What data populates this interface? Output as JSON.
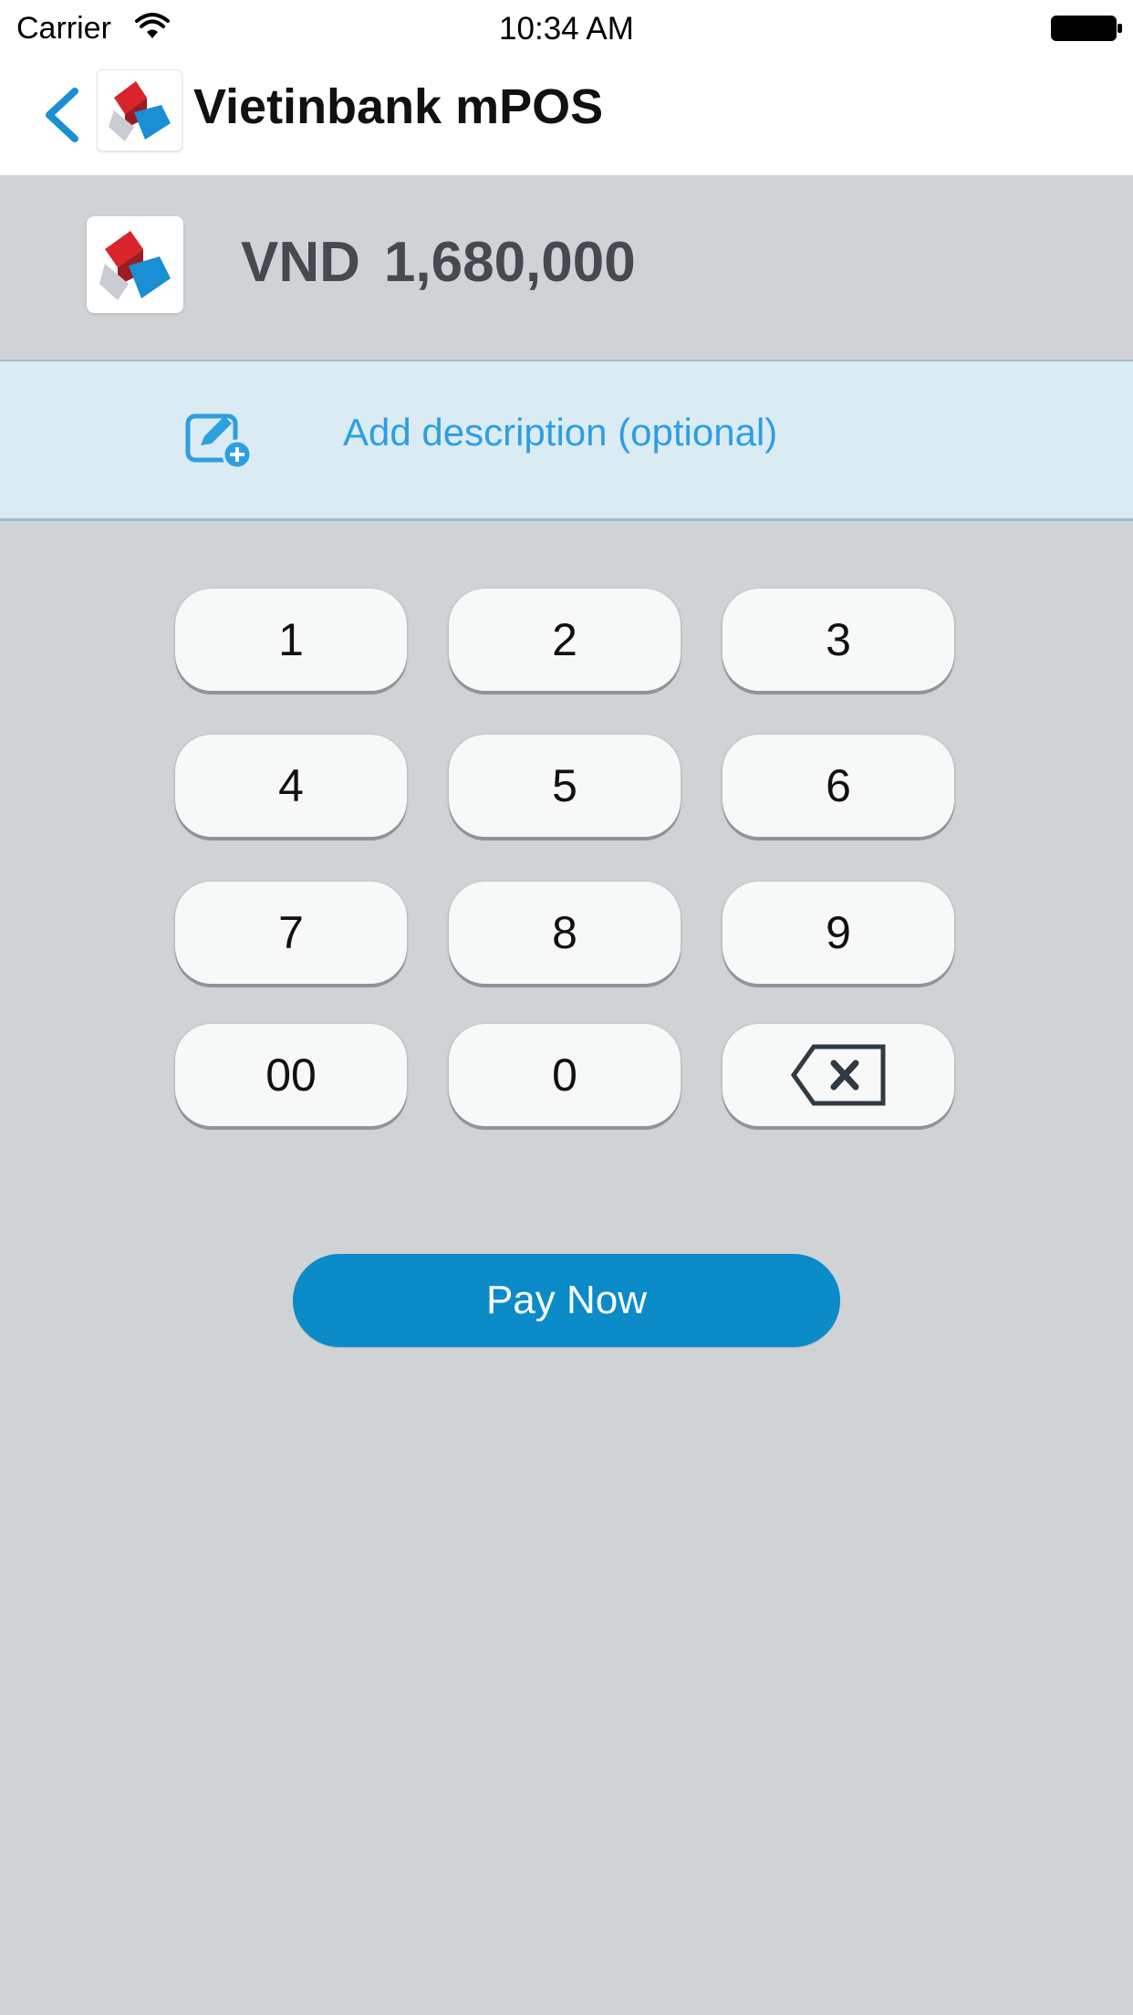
{
  "status_bar": {
    "carrier": "Carrier",
    "time": "10:34 AM",
    "icons": [
      "wifi-icon",
      "battery-icon"
    ]
  },
  "nav": {
    "back_icon": "chevron-left-icon",
    "logo_icon": "vietinbank-logo",
    "title": "Vietinbank mPOS"
  },
  "amount": {
    "logo_icon": "vietinbank-logo",
    "currency": "VND",
    "value": "1,680,000"
  },
  "description": {
    "icon": "edit-add-icon",
    "placeholder": "Add description (optional)"
  },
  "keypad": {
    "keys": [
      "1",
      "2",
      "3",
      "4",
      "5",
      "6",
      "7",
      "8",
      "9",
      "00",
      "0"
    ],
    "backspace_icon": "backspace-icon"
  },
  "pay_button": {
    "label": "Pay Now"
  },
  "colors": {
    "accent": "#0b8bc7",
    "link": "#2d9fe0",
    "background": "#cfd3d6",
    "description_bg": "#dbebf3",
    "logo_red": "#d9252a",
    "logo_blue": "#1a8fd4"
  }
}
